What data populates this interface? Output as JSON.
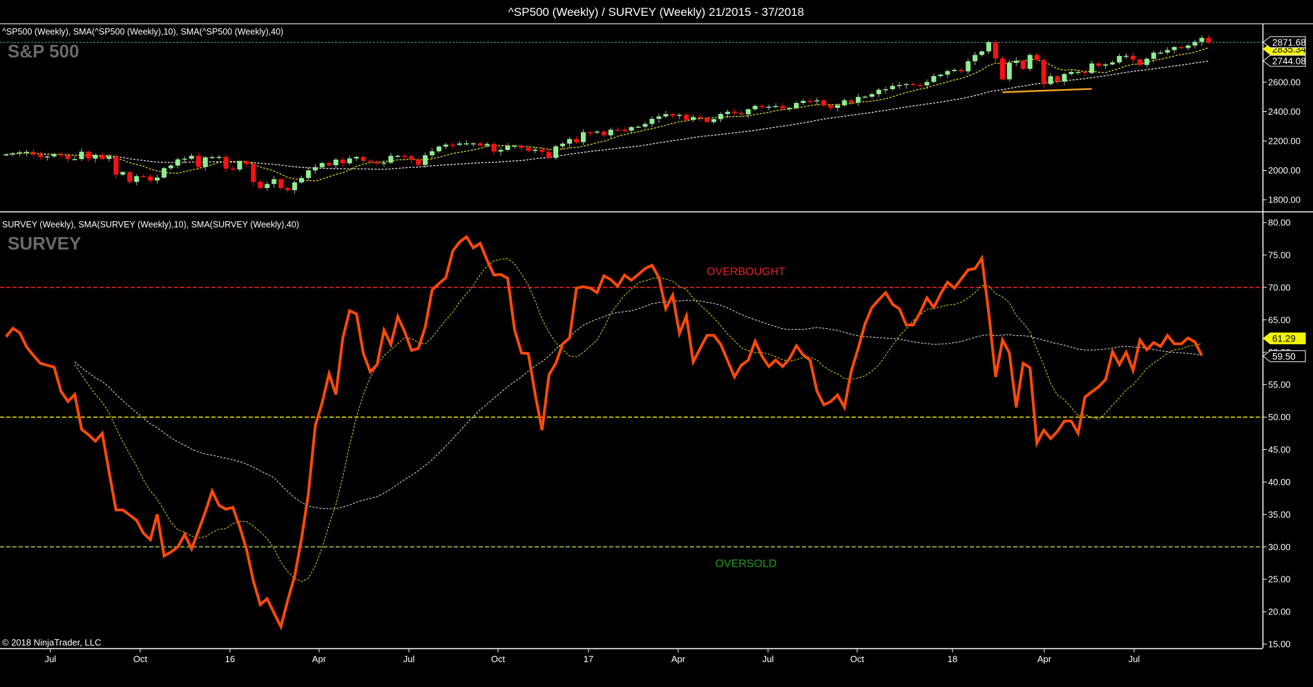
{
  "title": "^SP500 (Weekly) / SURVEY (Weekly)  21/2015 - 37/2018",
  "copyright": "© 2018 NinjaTrader, LLC",
  "x_axis": {
    "tick_labels": [
      "Jul",
      "Oct",
      "16",
      "Apr",
      "Jul",
      "Oct",
      "17",
      "Apr",
      "Jul",
      "Oct",
      "18",
      "Apr",
      "Jul"
    ]
  },
  "top_panel": {
    "legend": "^SP500 (Weekly),  SMA(^SP500 (Weekly),10),  SMA(^SP500 (Weekly),40)",
    "watermark": "S&P 500",
    "axis_labels": [
      {
        "value": 2600,
        "text": "2600.00"
      },
      {
        "value": 2400,
        "text": "2400.00"
      },
      {
        "value": 2200,
        "text": "2200.00"
      },
      {
        "value": 2000,
        "text": "2000.00"
      },
      {
        "value": 1800,
        "text": "1800.00"
      }
    ],
    "markers": [
      {
        "value": 2835.34,
        "text": "2835.34",
        "style": "sma10"
      },
      {
        "value": 2744.08,
        "text": "2744.08",
        "style": "sma40"
      },
      {
        "value": 2871.68,
        "text": "2871.68",
        "style": "last"
      }
    ]
  },
  "bottom_panel": {
    "legend": "SURVEY (Weekly),  SMA(SURVEY (Weekly),10),  SMA(SURVEY (Weekly),40)",
    "watermark": "SURVEY",
    "axis_labels": [
      "80.00",
      "75.00",
      "70.00",
      "65.00",
      "60.00",
      "55.00",
      "50.00",
      "45.00",
      "40.00",
      "35.00",
      "30.00",
      "25.00",
      "20.00",
      "15.00"
    ],
    "levels": [
      {
        "value": 70,
        "color": "#e8201c",
        "label": "OVERBOUGHT",
        "label_color": "#e8201c"
      },
      {
        "value": 50,
        "color": "#e6e600",
        "label": ""
      },
      {
        "value": 30,
        "color": "#a8d048",
        "label": "OVERSOLD",
        "label_color": "#1e9a1e"
      }
    ],
    "markers": [
      {
        "value": 61.29,
        "text": "61.29",
        "style": "sma10"
      },
      {
        "value": 59.5,
        "text": "59.50",
        "style": "last"
      }
    ]
  },
  "colors": {
    "up_candle": "#90ee90",
    "down_candle": "#ff1010",
    "survey_line": "#ff4a0a",
    "sma10": "#e0e020",
    "sma40": "#e8e8e8",
    "last_price_line": "#3fb8b0",
    "support_line": "#f0a020"
  },
  "chart_data": [
    {
      "type": "candlestick",
      "name": "^SP500 (Weekly)",
      "x_start": "2015-05-01",
      "x_interval": "weekly",
      "ylim": [
        1740,
        2950
      ],
      "overlays": [
        "SMA 10",
        "SMA 40"
      ],
      "support_line": {
        "from": "2018-02-09",
        "to": "2018-05-11",
        "price_from": 2532,
        "price_to": 2555
      },
      "close": [
        2108,
        2116,
        2123,
        2126,
        2107,
        2092,
        2095,
        2110,
        2102,
        2077,
        2077,
        2127,
        2080,
        2104,
        2078,
        2092,
        1971,
        1989,
        1921,
        1961,
        1958,
        1931,
        1951,
        2015,
        2033,
        2075,
        2079,
        2099,
        2023,
        2089,
        2090,
        2092,
        2012,
        2006,
        2061,
        2044,
        1922,
        1880,
        1907,
        1940,
        1880,
        1865,
        1918,
        1948,
        2000,
        2022,
        2050,
        2035,
        2073,
        2048,
        2081,
        2092,
        2065,
        2057,
        2047,
        2052,
        2099,
        2099,
        2096,
        2071,
        2037,
        2103,
        2130,
        2162,
        2175,
        2174,
        2183,
        2184,
        2184,
        2169,
        2180,
        2128,
        2139,
        2165,
        2168,
        2153,
        2133,
        2141,
        2126,
        2085,
        2164,
        2182,
        2213,
        2192,
        2260,
        2258,
        2264,
        2239,
        2277,
        2275,
        2271,
        2295,
        2297,
        2316,
        2351,
        2367,
        2383,
        2373,
        2378,
        2344,
        2363,
        2356,
        2329,
        2349,
        2384,
        2399,
        2391,
        2382,
        2416,
        2439,
        2432,
        2433,
        2438,
        2423,
        2425,
        2459,
        2473,
        2472,
        2477,
        2441,
        2426,
        2443,
        2477,
        2461,
        2500,
        2502,
        2519,
        2549,
        2553,
        2575,
        2581,
        2588,
        2582,
        2579,
        2602,
        2642,
        2652,
        2676,
        2684,
        2674,
        2743,
        2786,
        2810,
        2873,
        2762,
        2620,
        2732,
        2747,
        2691,
        2786,
        2752,
        2588,
        2641,
        2604,
        2656,
        2670,
        2670,
        2663,
        2728,
        2713,
        2721,
        2735,
        2779,
        2780,
        2755,
        2718,
        2760,
        2801,
        2802,
        2819,
        2840,
        2833,
        2850,
        2875,
        2902,
        2871.68
      ]
    },
    {
      "type": "line",
      "name": "SURVEY (Weekly)",
      "x_start": "2015-05-01",
      "x_interval": "weekly",
      "ylim": [
        15,
        80
      ],
      "overlays": [
        "SMA 10",
        "SMA 40"
      ],
      "values": [
        62.4,
        63.7,
        63.0,
        60.8,
        59.5,
        58.3,
        58.0,
        57.7,
        54.0,
        52.4,
        53.5,
        48.1,
        47.3,
        46.3,
        47.5,
        41.5,
        35.7,
        35.7,
        34.9,
        34.1,
        32.1,
        31.1,
        35.0,
        28.6,
        29.2,
        30.0,
        31.9,
        29.7,
        32.5,
        35.4,
        38.6,
        36.4,
        35.8,
        36.1,
        33.1,
        29.6,
        24.7,
        21.1,
        22.0,
        19.8,
        17.7,
        21.8,
        25.5,
        31.3,
        38.2,
        48.7,
        52.2,
        56.7,
        53.5,
        62.2,
        66.4,
        65.9,
        59.8,
        57.0,
        58.1,
        63.4,
        61.2,
        65.5,
        63.2,
        60.3,
        60.6,
        63.9,
        69.6,
        70.6,
        71.5,
        75.6,
        77.0,
        77.8,
        76.1,
        76.8,
        74.2,
        71.9,
        72.0,
        71.4,
        63.5,
        59.9,
        59.8,
        53.5,
        48.0,
        56.5,
        58.3,
        61.3,
        62.2,
        69.9,
        70.1,
        69.9,
        69.2,
        71.8,
        71.2,
        70.2,
        71.9,
        71.1,
        72.0,
        72.9,
        73.4,
        71.5,
        66.7,
        68.8,
        62.9,
        65.6,
        58.5,
        60.6,
        62.6,
        62.6,
        61.2,
        58.7,
        56.2,
        58.0,
        58.8,
        61.7,
        59.4,
        57.8,
        58.8,
        57.8,
        59.0,
        61.0,
        59.6,
        58.8,
        54.0,
        51.9,
        52.4,
        53.4,
        51.5,
        57.1,
        60.6,
        64.4,
        66.9,
        68.1,
        69.2,
        67.4,
        66.7,
        64.2,
        64.2,
        66.1,
        68.4,
        66.9,
        69.0,
        70.8,
        69.9,
        71.3,
        72.7,
        72.9,
        74.5,
        66.1,
        56.2,
        61.9,
        59.9,
        51.5,
        58.3,
        57.6,
        46.0,
        48.0,
        46.7,
        47.8,
        49.4,
        49.4,
        47.5,
        53.1,
        53.9,
        54.7,
        55.8,
        60.1,
        58.1,
        60.0,
        57.2,
        61.9,
        60.4,
        61.5,
        60.9,
        62.6,
        61.3,
        61.3,
        62.2,
        61.6,
        59.5
      ]
    }
  ]
}
